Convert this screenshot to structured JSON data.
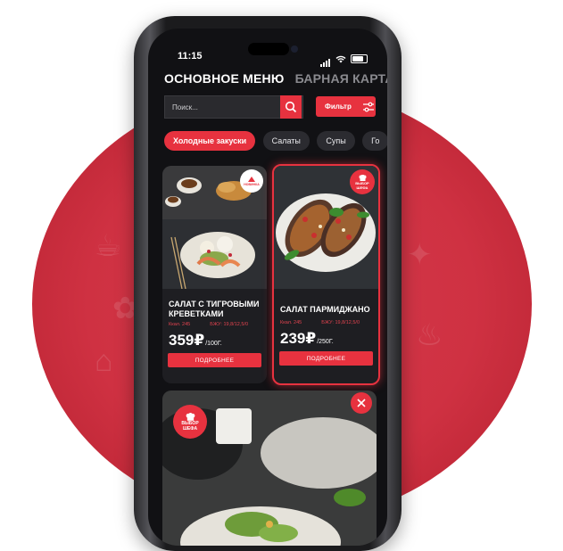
{
  "status_bar": {
    "time": "11:15"
  },
  "menu_tabs": [
    {
      "label": "ОСНОВНОЕ МЕНЮ",
      "active": true
    },
    {
      "label": "БАРНАЯ КАРТА",
      "active": false
    }
  ],
  "search": {
    "placeholder": "Поиск...",
    "value": ""
  },
  "filter": {
    "label": "Фильтр"
  },
  "categories": [
    {
      "label": "Холодные закуски",
      "active": true
    },
    {
      "label": "Салаты",
      "active": false
    },
    {
      "label": "Супы",
      "active": false
    },
    {
      "label": "Го",
      "active": false
    }
  ],
  "cards": [
    {
      "title": "САЛАТ С ТИГРОВЫМИ КРЕВЕТКАМИ",
      "kcal": "Ккал. 245",
      "bju": "БЖУ: 19,8/12,5/0",
      "price": "359₽",
      "unit": "/100Г.",
      "button": "ПОДРОБНЕЕ",
      "badge": "НОВИНКА"
    },
    {
      "title": "САЛАТ ПАРМИДЖАНО",
      "kcal": "Ккал. 245",
      "bju": "БЖУ: 19,8/12,5/0",
      "price": "239₽",
      "unit": "/250Г.",
      "button": "ПОДРОБНЕЕ",
      "badge_line1": "ВЫБОР",
      "badge_line2": "ШЕФА"
    }
  ],
  "card3": {
    "badge_line1": "ВЫБОР",
    "badge_line2": "ШЕФА"
  },
  "colors": {
    "accent": "#e7323f",
    "background": "#111114",
    "card": "#1e1e22",
    "blob": "#cf3142"
  },
  "icons": [
    "search-icon",
    "filter-sliders-icon",
    "close-icon",
    "chef-hat-icon",
    "wifi-icon",
    "battery-icon",
    "signal-icon"
  ]
}
